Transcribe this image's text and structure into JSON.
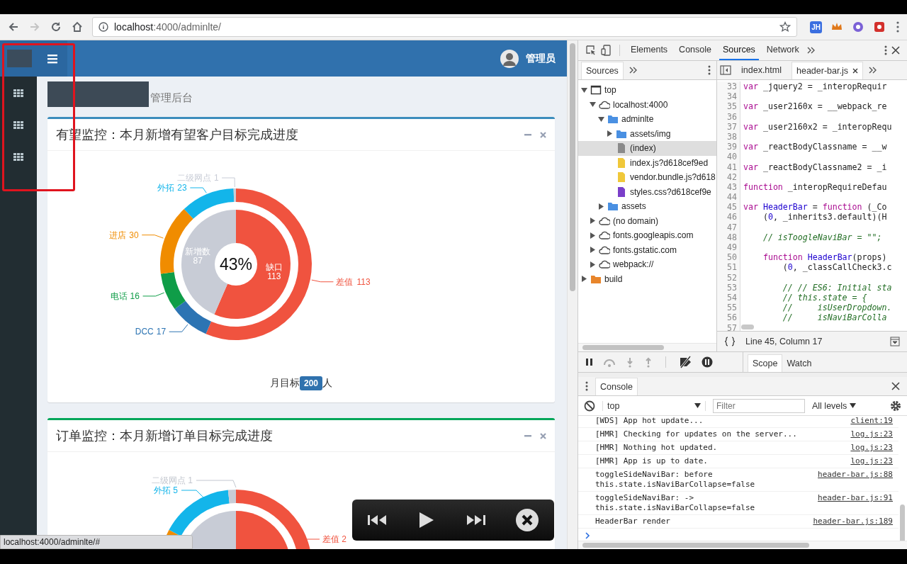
{
  "browser": {
    "address_host": "localhost",
    "address_path": ":4000/adminlte/",
    "extensions": [
      {
        "kind": "text",
        "label": "JH",
        "color": "#3b6fe0"
      },
      {
        "kind": "crown",
        "color": "#e0781a"
      },
      {
        "kind": "circle",
        "color": "#7b61d6"
      },
      {
        "kind": "square",
        "color": "#d3302c"
      }
    ]
  },
  "page": {
    "header": {
      "user_name": "管理员"
    },
    "breadcrumb": {
      "text": "管理后台"
    },
    "cards": [
      {
        "kind": "chart",
        "title": "有望监控：本月新增有望客户目标完成进度",
        "color": "#3c8dbc",
        "ring": {
          "chart_data": {
            "type": "donut",
            "categories": [
              "差值",
              "DCC",
              "电话",
              "进店",
              "外拓",
              "二级网点"
            ],
            "values": [
              113,
              17,
              16,
              30,
              23,
              1
            ],
            "data_labels": true
          }
        },
        "pie": {
          "chart_data": {
            "type": "donut",
            "categories": [
              "缺口",
              "新增数"
            ],
            "values": [
              113,
              87
            ],
            "data_labels": true
          },
          "center_label": "43%"
        },
        "footer": {
          "before": "月目标",
          "badge": "200",
          "after": "人"
        }
      },
      {
        "kind": "picture",
        "title": "订单监控：本月新增订单目标完成进度",
        "color": "#00a65a",
        "labels": [
          {
            "text": "二级网点 1",
            "color": "#c3c7cf"
          },
          {
            "text": "外拓 5",
            "color": "#13b5ea"
          },
          {
            "text": "差值 2",
            "color": "#f0533f"
          }
        ]
      }
    ],
    "status_bubble": "localhost:4000/adminlte/#"
  },
  "devtools": {
    "tabs": [
      {
        "label": "Elements",
        "selected": false
      },
      {
        "label": "Console",
        "selected": false
      },
      {
        "label": "Sources",
        "selected": true
      },
      {
        "label": "Network",
        "selected": false
      }
    ],
    "navigator": {
      "tab": "Sources",
      "tree": [
        {
          "label": "top",
          "kind": "frame",
          "expanded": true,
          "selected": false,
          "children": [
            {
              "label": "localhost:4000",
              "kind": "domain",
              "expanded": true,
              "selected": false,
              "children": [
                {
                  "label": "adminlte",
                  "kind": "folder",
                  "expanded": true,
                  "selected": false,
                  "children": [
                    {
                      "label": "assets/img",
                      "kind": "folder",
                      "expanded": false,
                      "selected": false
                    },
                    {
                      "label": "(index)",
                      "kind": "document",
                      "selected": true
                    },
                    {
                      "label": "index.js?d618cef9ed",
                      "kind": "script",
                      "selected": false
                    },
                    {
                      "label": "vendor.bundle.js?d618",
                      "kind": "script",
                      "selected": false
                    },
                    {
                      "label": "styles.css?d618cef9e",
                      "kind": "stylesheet",
                      "selected": false
                    }
                  ]
                },
                {
                  "label": "assets",
                  "kind": "folder",
                  "expanded": false,
                  "selected": false
                }
              ]
            },
            {
              "label": "(no domain)",
              "kind": "domain",
              "expanded": false,
              "selected": false
            },
            {
              "label": "fonts.googleapis.com",
              "kind": "domain",
              "expanded": false,
              "selected": false
            },
            {
              "label": "fonts.gstatic.com",
              "kind": "domain",
              "expanded": false,
              "selected": false
            },
            {
              "label": "webpack://",
              "kind": "domain",
              "expanded": false,
              "selected": false
            }
          ]
        },
        {
          "label": "build",
          "kind": "package",
          "expanded": false,
          "selected": false
        }
      ]
    },
    "editor": {
      "tabs": [
        {
          "label": "index.html",
          "selected": false,
          "closable": false
        },
        {
          "label": "header-bar.js",
          "selected": true,
          "closable": true
        }
      ],
      "lines": [
        {
          "number": "33",
          "tokens": [
            {
              "kind": "keyword",
              "text": "var"
            },
            {
              "kind": "plain",
              "text": " _jquery2 = _interopRequir"
            }
          ]
        },
        {
          "number": "34"
        },
        {
          "number": "35",
          "tokens": [
            {
              "kind": "keyword",
              "text": "var"
            },
            {
              "kind": "plain",
              "text": " _user2160x = __webpack_re"
            }
          ]
        },
        {
          "number": "36"
        },
        {
          "number": "37",
          "tokens": [
            {
              "kind": "keyword",
              "text": "var"
            },
            {
              "kind": "plain",
              "text": " _user2160x2 = _interopRequ"
            }
          ]
        },
        {
          "number": "38"
        },
        {
          "number": "39",
          "tokens": [
            {
              "kind": "keyword",
              "text": "var"
            },
            {
              "kind": "plain",
              "text": " _reactBodyClassname = __w"
            }
          ]
        },
        {
          "number": "40"
        },
        {
          "number": "41",
          "tokens": [
            {
              "kind": "keyword",
              "text": "var"
            },
            {
              "kind": "plain",
              "text": " _reactBodyClassname2 = _i"
            }
          ]
        },
        {
          "number": "42"
        },
        {
          "number": "43",
          "tokens": [
            {
              "kind": "keyword",
              "text": "function"
            },
            {
              "kind": "plain",
              "text": " _interopRequireDefau"
            }
          ]
        },
        {
          "number": "44"
        },
        {
          "number": "45",
          "tokens": [
            {
              "kind": "keyword",
              "text": "var"
            },
            {
              "kind": "definition",
              "text": " HeaderBar"
            },
            {
              "kind": "plain",
              "text": " = "
            },
            {
              "kind": "keyword",
              "text": "function"
            },
            {
              "kind": "plain",
              "text": " (_Co"
            }
          ]
        },
        {
          "number": "46",
          "tokens": [
            {
              "kind": "plain",
              "text": "    ("
            },
            {
              "kind": "number",
              "text": "0"
            },
            {
              "kind": "plain",
              "text": ", _inherits3.default)(H"
            }
          ]
        },
        {
          "number": "47"
        },
        {
          "number": "48",
          "tokens": [
            {
              "kind": "comment",
              "text": "    // isToogleNaviBar = \"\";"
            }
          ]
        },
        {
          "number": "49"
        },
        {
          "number": "50",
          "tokens": [
            {
              "kind": "keyword",
              "text": "    function"
            },
            {
              "kind": "definition",
              "text": " HeaderBar"
            },
            {
              "kind": "plain",
              "text": "(props)"
            }
          ]
        },
        {
          "number": "51",
          "tokens": [
            {
              "kind": "plain",
              "text": "        ("
            },
            {
              "kind": "number",
              "text": "0"
            },
            {
              "kind": "plain",
              "text": ", _classCallCheck3.c"
            }
          ]
        },
        {
          "number": "52"
        },
        {
          "number": "53",
          "tokens": [
            {
              "kind": "comment",
              "text": "        // // ES6: Initial sta"
            }
          ]
        },
        {
          "number": "54",
          "tokens": [
            {
              "kind": "comment",
              "text": "        // this.state = {"
            }
          ]
        },
        {
          "number": "55",
          "tokens": [
            {
              "kind": "comment",
              "text": "        //     isUserDropdown."
            }
          ]
        },
        {
          "number": "56",
          "tokens": [
            {
              "kind": "comment",
              "text": "        //     isNaviBarColla"
            }
          ]
        },
        {
          "number": "57"
        }
      ],
      "status": "Line 45, Column 17"
    },
    "debugger": {
      "tabs": [
        {
          "label": "Scope",
          "selected": true
        },
        {
          "label": "Watch",
          "selected": false
        }
      ]
    },
    "console": {
      "tab": "Console",
      "context": "top",
      "filter_placeholder": "Filter",
      "levels": "All levels",
      "messages": [
        {
          "text": "[WDS] App hot update...",
          "source": "client:19"
        },
        {
          "text": "[HMR] Checking for updates on the server...",
          "source": "log.js:23"
        },
        {
          "text": "[HMR] Nothing hot updated.",
          "source": "log.js:23"
        },
        {
          "text": "[HMR] App is up to date.",
          "source": "log.js:23"
        },
        {
          "text": "toggleSideNaviBar: before this.state.isNaviBarCollapse=false",
          "source": "header-bar.js:88"
        },
        {
          "text": "toggleSideNaviBar: -> this.state.isNaviBarCollapse=false",
          "source": "header-bar.js:91"
        },
        {
          "text": "HeaderBar render",
          "source": "header-bar.js:189"
        }
      ]
    }
  }
}
